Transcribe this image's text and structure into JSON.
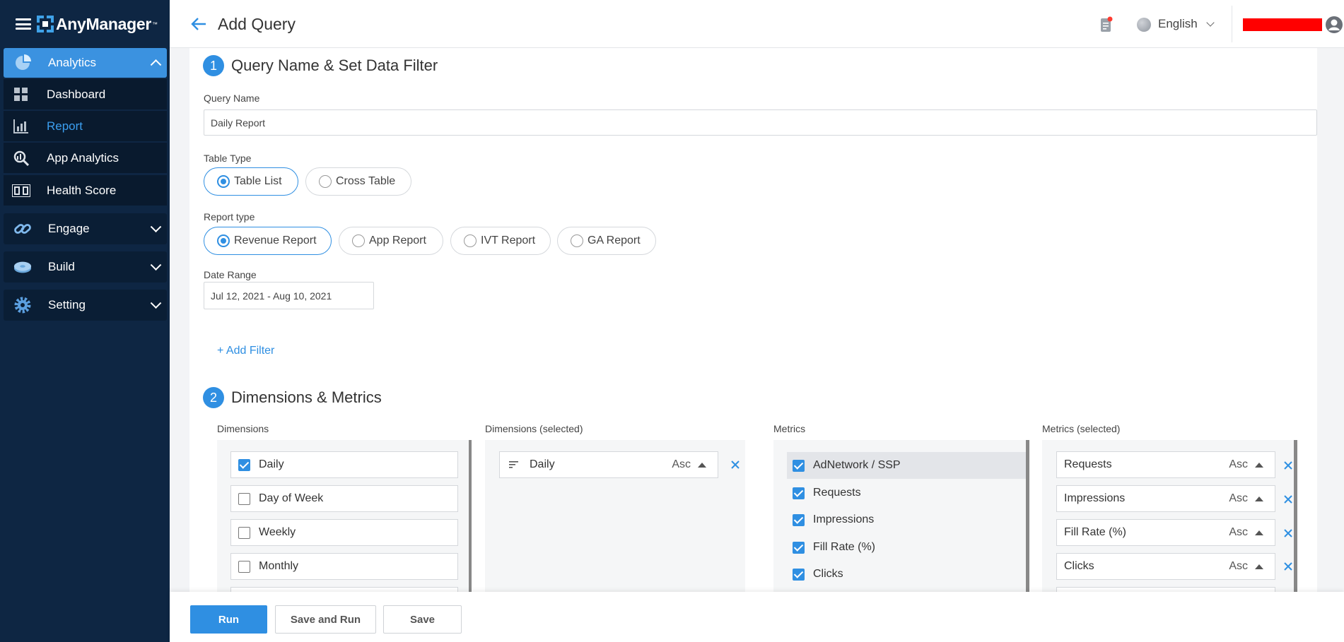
{
  "app": {
    "name": "AnyManager",
    "tm": "™"
  },
  "sidebar": {
    "items": [
      {
        "label": "Analytics",
        "icon": "analytics-pie-icon",
        "expanded": true
      },
      {
        "label": "Dashboard",
        "icon": "dashboard-grid-icon"
      },
      {
        "label": "Report",
        "icon": "report-bar-chart-icon",
        "active": true
      },
      {
        "label": "App Analytics",
        "icon": "app-analytics-search-icon"
      },
      {
        "label": "Health Score",
        "icon": "health-score-icon"
      },
      {
        "label": "Engage",
        "icon": "engage-link-icon"
      },
      {
        "label": "Build",
        "icon": "build-disc-icon"
      },
      {
        "label": "Setting",
        "icon": "setting-gear-icon"
      }
    ]
  },
  "header": {
    "title": "Add Query",
    "language": "English"
  },
  "section1": {
    "number": "1",
    "title": "Query Name & Set Data Filter",
    "query_name_label": "Query Name",
    "query_name_value": "Daily Report",
    "table_type_label": "Table Type",
    "table_types": [
      "Table List",
      "Cross Table"
    ],
    "table_type_selected": "Table List",
    "report_type_label": "Report type",
    "report_types": [
      "Revenue Report",
      "App Report",
      "IVT Report",
      "GA Report"
    ],
    "report_type_selected": "Revenue Report",
    "date_range_label": "Date Range",
    "date_range_value": "Jul 12, 2021 - Aug 10, 2021",
    "add_filter": "+ Add Filter"
  },
  "section2": {
    "number": "2",
    "title": "Dimensions & Metrics",
    "dimensions_label": "Dimensions",
    "dimensions": [
      {
        "label": "Daily",
        "checked": true
      },
      {
        "label": "Day of Week",
        "checked": false
      },
      {
        "label": "Weekly",
        "checked": false
      },
      {
        "label": "Monthly",
        "checked": false
      }
    ],
    "dimensions_selected_label": "Dimensions (selected)",
    "dimensions_selected": [
      {
        "label": "Daily",
        "sort": "Asc"
      }
    ],
    "metrics_label": "Metrics",
    "metrics": [
      {
        "label": "AdNetwork / SSP",
        "checked": true
      },
      {
        "label": "Requests",
        "checked": true
      },
      {
        "label": "Impressions",
        "checked": true
      },
      {
        "label": "Fill Rate (%)",
        "checked": true
      },
      {
        "label": "Clicks",
        "checked": true
      }
    ],
    "metrics_selected_label": "Metrics (selected)",
    "metrics_selected": [
      {
        "label": "Requests",
        "sort": "Asc"
      },
      {
        "label": "Impressions",
        "sort": "Asc"
      },
      {
        "label": "Fill Rate (%)",
        "sort": "Asc"
      },
      {
        "label": "Clicks",
        "sort": "Asc"
      }
    ]
  },
  "footer": {
    "run": "Run",
    "save_and_run": "Save and Run",
    "save": "Save"
  },
  "colors": {
    "sidebar_bg": "#0e2643",
    "accent": "#2f8fe2",
    "redacted": "#ff0000"
  }
}
